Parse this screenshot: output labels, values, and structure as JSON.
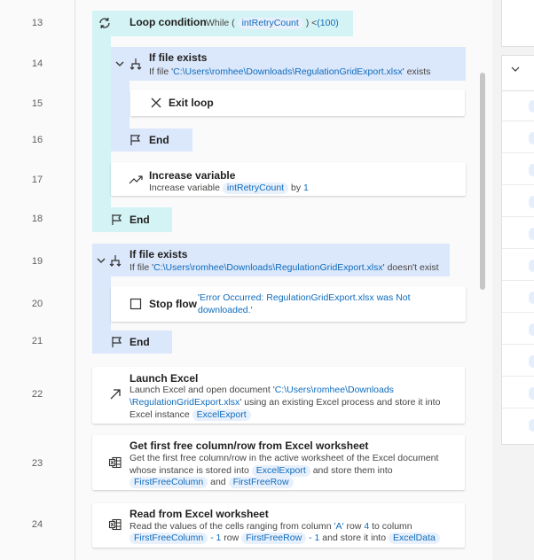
{
  "line_numbers": [
    "13",
    "14",
    "15",
    "16",
    "17",
    "18",
    "19",
    "20",
    "21",
    "22",
    "23",
    "24"
  ],
  "flow": {
    "loop": {
      "title": "Loop condition",
      "kw": "While (",
      "var": "intRetryCount",
      "close": ") <",
      "limit": "(100)"
    },
    "if1": {
      "title": "If file exists",
      "prefix": "If file '",
      "path": "C:\\Users\\romhee\\Downloads\\RegulationGridExport.xlsx",
      "suffix": "' exists"
    },
    "exit_loop": {
      "title": "Exit loop"
    },
    "end_if1": "End",
    "increase": {
      "title": "Increase variable",
      "prefix": "Increase variable",
      "var": "intRetryCount",
      "by": "by",
      "amount": "1"
    },
    "end_loop": "End",
    "if2": {
      "title": "If file exists",
      "prefix": "If file '",
      "path": "C:\\Users\\romhee\\Downloads\\RegulationGridExport.xlsx",
      "suffix": "' doesn't exist"
    },
    "stop": {
      "title": "Stop flow",
      "msg_line1": "'Error Occurred: RegulationGridExport.xlsx was Not",
      "msg_line2": "downloaded.'"
    },
    "end_if2": "End",
    "launch": {
      "title": "Launch Excel",
      "l1_prefix": "Launch Excel and open document '",
      "l1_path": "C:\\Users\\romhee\\Downloads",
      "l2_path": "\\RegulationGridExport.xlsx",
      "l2_suffix": "' using an existing Excel process and store it into",
      "l3_prefix": "Excel instance",
      "l3_var": "ExcelExport"
    },
    "first_free": {
      "title": "Get first free column/row from Excel worksheet",
      "l1": "Get the first free column/row in the active worksheet of the Excel document",
      "l2_prefix": "whose instance is stored into",
      "l2_var": "ExcelExport",
      "l2_suffix": "and store them into",
      "l3_var1": "FirstFreeColumn",
      "l3_and": "and",
      "l3_var2": "FirstFreeRow"
    },
    "read": {
      "title": "Read from Excel worksheet",
      "l1_prefix": "Read the values of the cells ranging from column",
      "l1_col": "'A'",
      "l1_row": "row",
      "l1_rownum": "4",
      "l1_to": "to column",
      "l2_var1": "FirstFreeColumn",
      "l2_minus1": "- 1",
      "l2_row": "row",
      "l2_var2": "FirstFreeRow",
      "l2_minus2": "- 1",
      "l2_store": "and store it into",
      "l2_var3": "ExcelData"
    }
  },
  "colors": {
    "loop_block": "#d4f3f5",
    "if_block": "#dbe7fb",
    "variable_pill": "#e8f0fc",
    "accent_text": "#0f6cbd"
  }
}
